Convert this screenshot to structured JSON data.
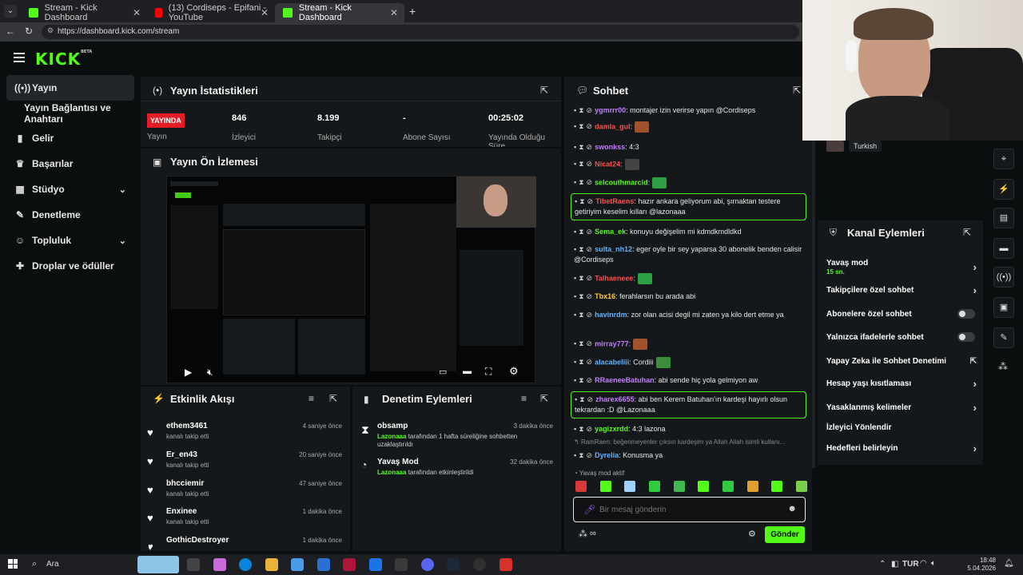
{
  "browser": {
    "tabs": [
      {
        "title": "Stream - Kick Dashboard"
      },
      {
        "title": "(13) Cordiseps - Epifani - YouTube"
      },
      {
        "title": "Stream - Kick Dashboard"
      }
    ],
    "url": "https://dashboard.kick.com/stream"
  },
  "brand": {
    "logo": "KICK",
    "beta": "BETA",
    "accent": "#53fc18"
  },
  "sidebar": {
    "items": [
      {
        "label": "Yayın",
        "icon": "broadcast-icon"
      },
      {
        "label": "Yayın Bağlantısı ve Anahtarı",
        "icon": ""
      },
      {
        "label": "Gelir",
        "icon": "bar-chart-icon"
      },
      {
        "label": "Başarılar",
        "icon": "trophy-icon"
      },
      {
        "label": "Stüdyo",
        "icon": "grid-icon"
      },
      {
        "label": "Denetleme",
        "icon": "wrench-icon"
      },
      {
        "label": "Topluluk",
        "icon": "people-icon"
      },
      {
        "label": "Droplar ve ödüller",
        "icon": "gift-icon"
      }
    ]
  },
  "stats": {
    "title": "Yayın İstatistikleri",
    "live_badge": "YAYINDA",
    "stream_label": "Yayın",
    "cells": [
      {
        "value": "846",
        "label": "İzleyici"
      },
      {
        "value": "8.199",
        "label": "Takipçi"
      },
      {
        "value": "-",
        "label": "Abone Sayısı"
      },
      {
        "value": "00:25:02",
        "label": "Yayında Olduğu Süre"
      }
    ]
  },
  "preview": {
    "title": "Yayın Ön İzlemesi"
  },
  "activity": {
    "title": "Etkinlik Akışı",
    "items": [
      {
        "name": "ethem3461",
        "sub": "kanalı takip etti",
        "time": "4 saniye önce"
      },
      {
        "name": "Er_en43",
        "sub": "kanalı takip etti",
        "time": "20 saniye önce"
      },
      {
        "name": "bhcciemir",
        "sub": "kanalı takip etti",
        "time": "47 saniye önce"
      },
      {
        "name": "Enxinee",
        "sub": "kanalı takip etti",
        "time": "1 dakika önce"
      },
      {
        "name": "GothicDestroyer",
        "sub": "",
        "time": "1 dakika önce"
      }
    ]
  },
  "moderation": {
    "title": "Denetim Eylemleri",
    "items": [
      {
        "name": "obsamp",
        "actor": "Lazonaaa",
        "text": "tarafından 1 hafta süreliğine sohbetten uzaklaştırıldı",
        "time": "3 dakika önce"
      },
      {
        "name": "Yavaş Mod",
        "actor": "Lazonaaa",
        "text": "tarafından etkinleştirildi",
        "time": "32 dakika önce"
      }
    ]
  },
  "chat": {
    "title": "Sohbet",
    "messages": [
      {
        "user": "ygmrrr00",
        "color": "#c27bff",
        "text": ": montajer izin verirse yapın @Cordiseps",
        "hl": false
      },
      {
        "user": "damla_gul",
        "color": "#ff4d4d",
        "text": ":",
        "hl": false,
        "emote": "#a0522d"
      },
      {
        "user": "swonkss",
        "color": "#c27bff",
        "text": ": 4:3",
        "hl": false
      },
      {
        "user": "Nicat24",
        "color": "#ff4d4d",
        "text": ":",
        "hl": false,
        "emote": "#444"
      },
      {
        "user": "selcouthmarcid",
        "color": "#53fc18",
        "text": ":",
        "hl": false,
        "emote": "#2ea043"
      },
      {
        "user": "TibetRaens",
        "color": "#ff4d4d",
        "text": ": hazır ankara geliyorum abi, şırnaktan testere getiriyim keselim kılları @lazonaaa",
        "hl": true
      },
      {
        "user": "Sema_ek",
        "color": "#53fc18",
        "text": ": konuyu değişelim mi kdmdkmdldkd",
        "hl": false
      },
      {
        "user": "sulta_nh12",
        "color": "#5fb3ff",
        "text": ": eger oyle bir sey yaparsa 30 abonelik benden calisir @Cordiseps",
        "hl": false
      },
      {
        "user": "Talhaeneee",
        "color": "#ff4d4d",
        "text": ":",
        "hl": false,
        "emote": "#2ea043"
      },
      {
        "user": "Tbx16",
        "color": "#ffcc33",
        "text": ": ferahlarsın bu arada abi",
        "hl": false
      },
      {
        "user": "havinrdm",
        "color": "#5fb3ff",
        "text": ": zor olan acisi degil mi zaten ya kilo dert etme ya",
        "hl": false
      },
      {
        "user": "mirray777",
        "color": "#c27bff",
        "text": ":",
        "hl": false,
        "emote": "#a0522d"
      },
      {
        "user": "alacabeliii",
        "color": "#5fb3ff",
        "text": ": Cordiii",
        "hl": false,
        "emote": "#3c8d3c"
      },
      {
        "user": "RRaeneeBatuhan",
        "color": "#c27bff",
        "text": ": abi sende hiç yola gelmiyon aw",
        "hl": false
      },
      {
        "user": "zharex6655",
        "color": "#c27bff",
        "text": ": abi ben Kerem Batuhan'ın kardeşi hayırlı olsun tekrardan :D @Lazonaaa",
        "hl": true
      },
      {
        "user": "yagizxrdd",
        "color": "#53fc18",
        "text": ": 4:3 lazona",
        "hl": false
      },
      {
        "user": "Dyrelia",
        "color": "#5fb3ff",
        "text": ": Konusma ya",
        "hl": false
      }
    ],
    "reply_preview": "RamRaen: beğenmeyenler çıksın kardeşim ya Allah Allah isimli kullanı...",
    "slow_mode_note": "Yavaş mod aktif",
    "input_placeholder": "Bir mesaj gönderin",
    "send_label": "Gönder"
  },
  "channel_actions": {
    "title": "Kanal Eylemleri",
    "items": [
      {
        "label": "Yavaş mod",
        "sub": "15 sn.",
        "control": "chevron"
      },
      {
        "label": "Takipçilere özel sohbet",
        "sub": "",
        "control": "chevron"
      },
      {
        "label": "Abonelere özel sohbet",
        "sub": "",
        "control": "toggle"
      },
      {
        "label": "Yalnızca ifadelerle sohbet",
        "sub": "",
        "control": "toggle"
      },
      {
        "label": "Yapay Zeka ile Sohbet Denetimi",
        "sub": "",
        "control": "external"
      },
      {
        "label": "Hesap yaşı kısıtlaması",
        "sub": "",
        "control": "chevron"
      },
      {
        "label": "Yasaklanmış kelimeler",
        "sub": "",
        "control": "chevron"
      },
      {
        "label": "İzleyici Yönlendir",
        "sub": "",
        "control": "none"
      },
      {
        "label": "Hedefleri belirleyin",
        "sub": "",
        "control": "chevron"
      }
    ]
  },
  "webcam": {
    "lang_tag": "Turkish"
  },
  "taskbar": {
    "search": "Ara",
    "lang": "TUR",
    "time": "18:48",
    "date": "5.04.2026"
  }
}
